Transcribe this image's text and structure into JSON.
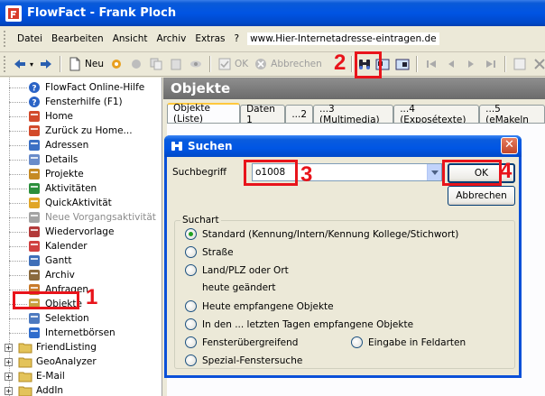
{
  "window": {
    "title": "FlowFact - Frank Ploch"
  },
  "menubar": {
    "items": [
      "Datei",
      "Bearbeiten",
      "Ansicht",
      "Archiv",
      "Extras",
      "?"
    ],
    "url": "www.Hier-Internetadresse-eintragen.de"
  },
  "toolbar": {
    "new_label": "Neu",
    "ok_label": "OK",
    "cancel_label": "Abbrechen"
  },
  "tree": {
    "items": [
      {
        "label": "FlowFact Online-Hilfe",
        "icon": "help-icon"
      },
      {
        "label": "Fensterhilfe (F1)",
        "icon": "help-icon"
      },
      {
        "label": "Home",
        "icon": "home-icon"
      },
      {
        "label": "Zurück zu Home...",
        "icon": "home-back-icon"
      },
      {
        "label": "Adressen",
        "icon": "address-card-icon"
      },
      {
        "label": "Details",
        "icon": "details-icon"
      },
      {
        "label": "Projekte",
        "icon": "projects-icon"
      },
      {
        "label": "Aktivitäten",
        "icon": "activities-icon"
      },
      {
        "label": "QuickAktivität",
        "icon": "quick-activity-icon"
      },
      {
        "label": "Neue Vorgangsaktivität",
        "icon": "new-activity-icon"
      },
      {
        "label": "Wiedervorlage",
        "icon": "resubmission-icon"
      },
      {
        "label": "Kalender",
        "icon": "calendar-icon"
      },
      {
        "label": "Gantt",
        "icon": "gantt-icon"
      },
      {
        "label": "Archiv",
        "icon": "archive-icon"
      },
      {
        "label": "Anfragen",
        "icon": "requests-icon"
      },
      {
        "label": "Objekte",
        "icon": "objects-icon"
      },
      {
        "label": "Selektion",
        "icon": "selection-icon"
      },
      {
        "label": "Internetbörsen",
        "icon": "internet-icon"
      },
      {
        "label": "FriendListing",
        "icon": "folder-icon"
      },
      {
        "label": "GeoAnalyzer",
        "icon": "folder-icon"
      },
      {
        "label": "E-Mail",
        "icon": "folder-icon"
      },
      {
        "label": "AddIn",
        "icon": "folder-icon"
      }
    ]
  },
  "panel": {
    "title": "Objekte",
    "tabs": [
      "Objekte (Liste)",
      "Daten 1",
      "...2",
      "...3 (Multimedia)",
      "...4 (Exposétexte)",
      "...5 (eMakeln"
    ]
  },
  "dialog": {
    "title": "Suchen",
    "search_label": "Suchbegriff",
    "search_value": "o1008",
    "ok_label": "OK",
    "cancel_label": "Abbrechen",
    "group_label": "Suchart",
    "options": {
      "standard": "Standard (Kennung/Intern/Kennung Kollege/Stichwort)",
      "strasse": "Straße",
      "land": "Land/PLZ oder Ort",
      "heute_geaendert": "heute geändert",
      "heute_empfangen": "Heute empfangene Objekte",
      "letzte_tage": "In den ... letzten Tagen empfangene Objekte",
      "fensteruebergreifend": "Fensterübergreifend",
      "eingabe_feldarten": "Eingabe in Feldarten",
      "spezial": "Spezial-Fenstersuche"
    }
  },
  "annotations": {
    "n1": "1",
    "n2": "2",
    "n3": "3",
    "n4": "4"
  }
}
